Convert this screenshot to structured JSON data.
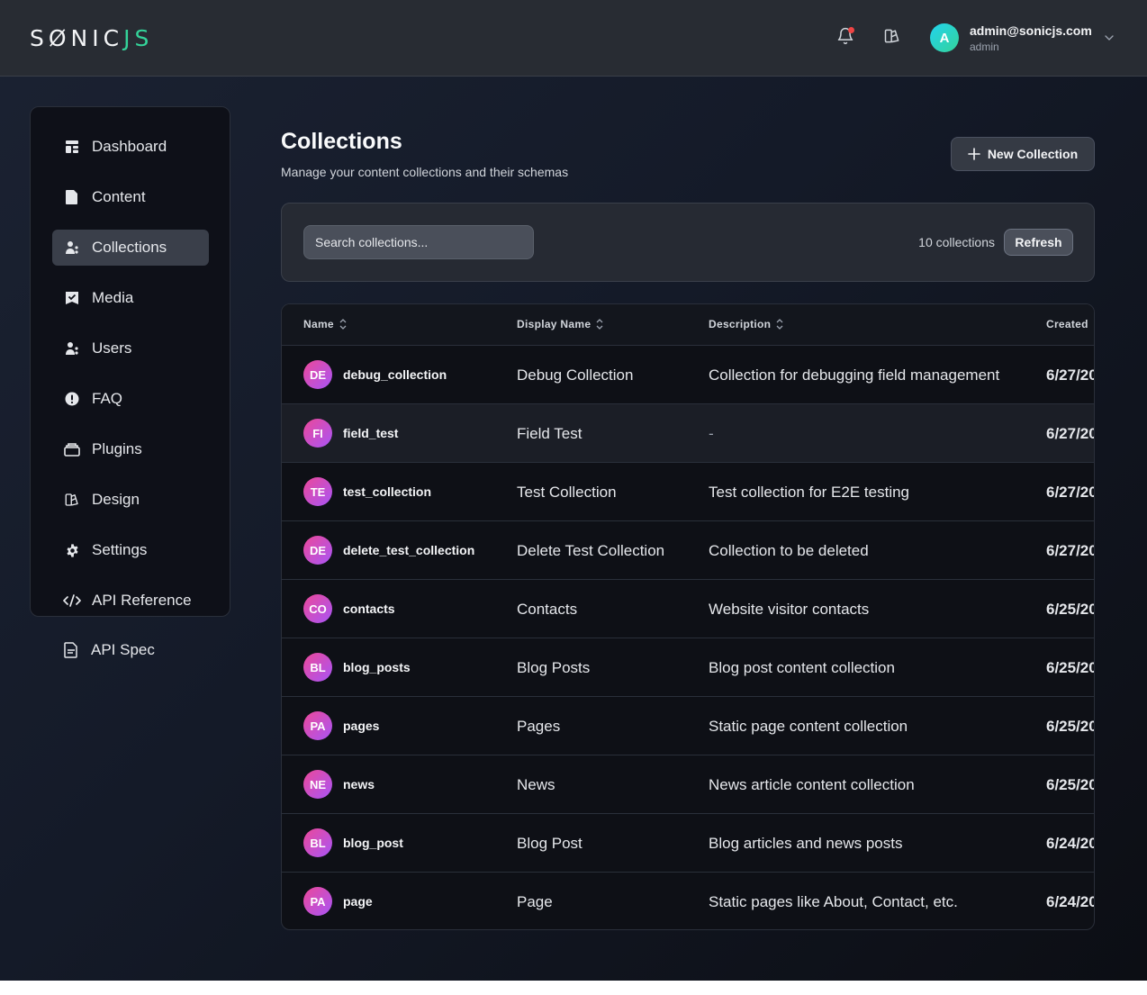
{
  "brand": {
    "logo_part1": "SØNIC",
    "logo_part2": "JS"
  },
  "header": {
    "user_initial": "A",
    "user_email": "admin@sonicjs.com",
    "user_role": "admin"
  },
  "sidebar": {
    "items": [
      {
        "label": "Dashboard",
        "icon": "dashboard-icon"
      },
      {
        "label": "Content",
        "icon": "document-icon"
      },
      {
        "label": "Collections",
        "icon": "collections-icon",
        "active": true
      },
      {
        "label": "Media",
        "icon": "media-icon"
      },
      {
        "label": "Users",
        "icon": "users-icon"
      },
      {
        "label": "FAQ",
        "icon": "faq-icon"
      },
      {
        "label": "Plugins",
        "icon": "plugins-icon"
      },
      {
        "label": "Design",
        "icon": "design-icon"
      },
      {
        "label": "Settings",
        "icon": "gear-icon"
      },
      {
        "label": "API Reference",
        "icon": "code-icon"
      },
      {
        "label": "API Spec",
        "icon": "file-icon"
      }
    ]
  },
  "main": {
    "title": "Collections",
    "subtitle": "Manage your content collections and their schemas",
    "new_button_label": "New Collection",
    "search_placeholder": "Search collections...",
    "count_text": "10 collections",
    "refresh_label": "Refresh",
    "columns": [
      "Name",
      "Display Name",
      "Description",
      "Created"
    ],
    "rows": [
      {
        "badge": "DE",
        "name": "debug_collection",
        "display": "Debug Collection",
        "description": "Collection for debugging field management",
        "created": "6/27/20"
      },
      {
        "badge": "FI",
        "name": "field_test",
        "display": "Field Test",
        "description": "-",
        "created": "6/27/20"
      },
      {
        "badge": "TE",
        "name": "test_collection",
        "display": "Test Collection",
        "description": "Test collection for E2E testing",
        "created": "6/27/20"
      },
      {
        "badge": "DE",
        "name": "delete_test_collection",
        "display": "Delete Test Collection",
        "description": "Collection to be deleted",
        "created": "6/27/20"
      },
      {
        "badge": "CO",
        "name": "contacts",
        "display": "Contacts",
        "description": "Website visitor contacts",
        "created": "6/25/20"
      },
      {
        "badge": "BL",
        "name": "blog_posts",
        "display": "Blog Posts",
        "description": "Blog post content collection",
        "created": "6/25/20"
      },
      {
        "badge": "PA",
        "name": "pages",
        "display": "Pages",
        "description": "Static page content collection",
        "created": "6/25/20"
      },
      {
        "badge": "NE",
        "name": "news",
        "display": "News",
        "description": "News article content collection",
        "created": "6/25/20"
      },
      {
        "badge": "BL",
        "name": "blog_post",
        "display": "Blog Post",
        "description": "Blog articles and news posts",
        "created": "6/24/20"
      },
      {
        "badge": "PA",
        "name": "page",
        "display": "Page",
        "description": "Static pages like About, Contact, etc.",
        "created": "6/24/20"
      }
    ]
  },
  "colors": {
    "accent": "#34d399",
    "badge_gradient_start": "#ec4899",
    "badge_gradient_end": "#a855f7",
    "notification_dot": "#ef4444"
  }
}
